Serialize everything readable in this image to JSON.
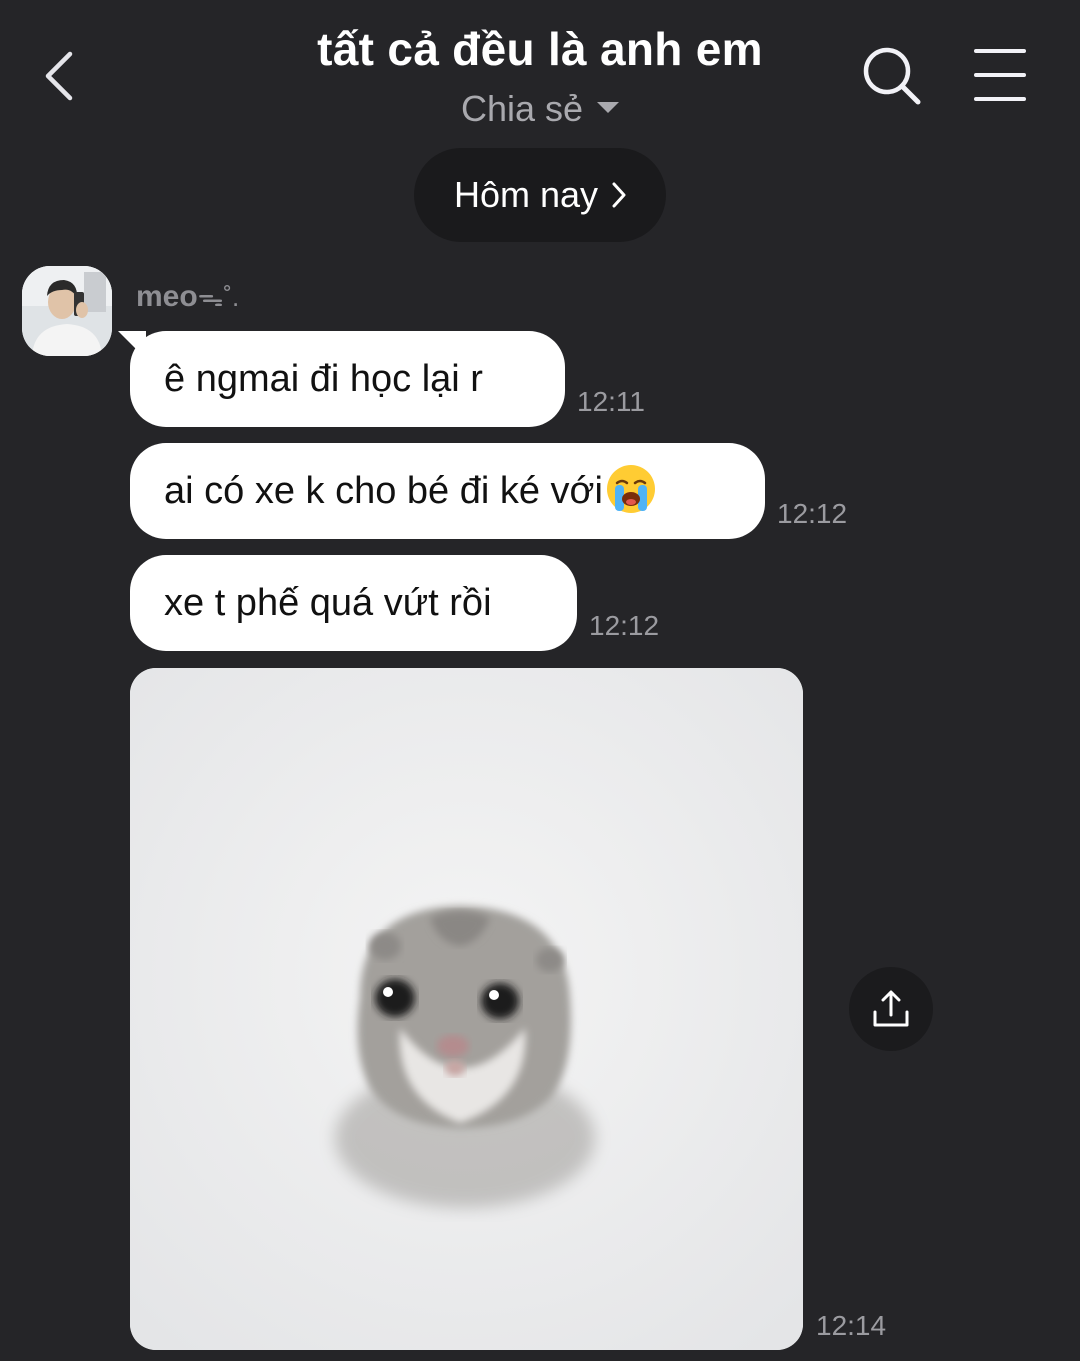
{
  "header": {
    "title": "tất cả đều là anh em",
    "subtitle": "Chia sẻ",
    "back_icon": "chevron-left-icon",
    "search_icon": "search-icon",
    "menu_icon": "hamburger-menu-icon"
  },
  "date_pill": {
    "label": "Hôm nay"
  },
  "sender": {
    "name": "meo",
    "decoration": "ᯓ˚."
  },
  "messages": [
    {
      "text": "ê ngmai đi học lại r",
      "time": "12:11"
    },
    {
      "text": "ai có xe k cho bé đi ké với",
      "emoji": "loudly-crying-face",
      "time": "12:12"
    },
    {
      "text": "xe t phế quá vứt rồi",
      "time": "12:12"
    },
    {
      "type": "image",
      "description_icon": "sad-hamster-photo",
      "time": "12:14"
    }
  ],
  "colors": {
    "background": "#252528",
    "bubble": "#ffffff",
    "pill": "#1a1a1c",
    "muted": "#9b9ba0"
  }
}
